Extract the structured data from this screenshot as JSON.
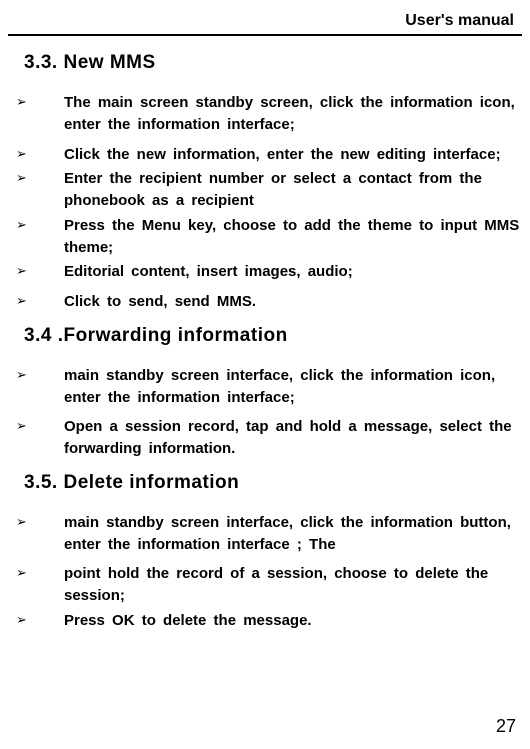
{
  "header": {
    "title": "User's manual"
  },
  "sections": [
    {
      "title": "3.3.  New  MMS",
      "items": [
        "The  main  screen  standby  screen,  click  the  information  icon,  enter  the  information  interface;",
        "Click  the  new  information,  enter  the  new  editing  interface;",
        "Enter  the  recipient  number  or  select  a  contact  from  the  phonebook  as  a  recipient",
        "Press  the  Menu  key,  choose  to  add  the  theme  to  input  MMS  theme;",
        "Editorial  content,  insert  images,  audio;",
        "Click  to  send,  send  MMS."
      ]
    },
    {
      "title": "3.4  .Forwarding  information",
      "items": [
        "main  standby  screen  interface,  click  the  information  icon,  enter  the  information  interface;",
        "Open  a  session  record,  tap  and  hold  a  message,  select  the  forwarding  information."
      ]
    },
    {
      "title": "3.5.  Delete  information",
      "items": [
        "main  standby  screen  interface,  click  the  information  button,  enter  the  information  interface  ;  The",
        "point  hold  the  record  of  a  session,  choose  to  delete  the  session;",
        "Press  OK  to  delete  the  message."
      ]
    }
  ],
  "bullet_glyph": "➢",
  "page_number": "27"
}
